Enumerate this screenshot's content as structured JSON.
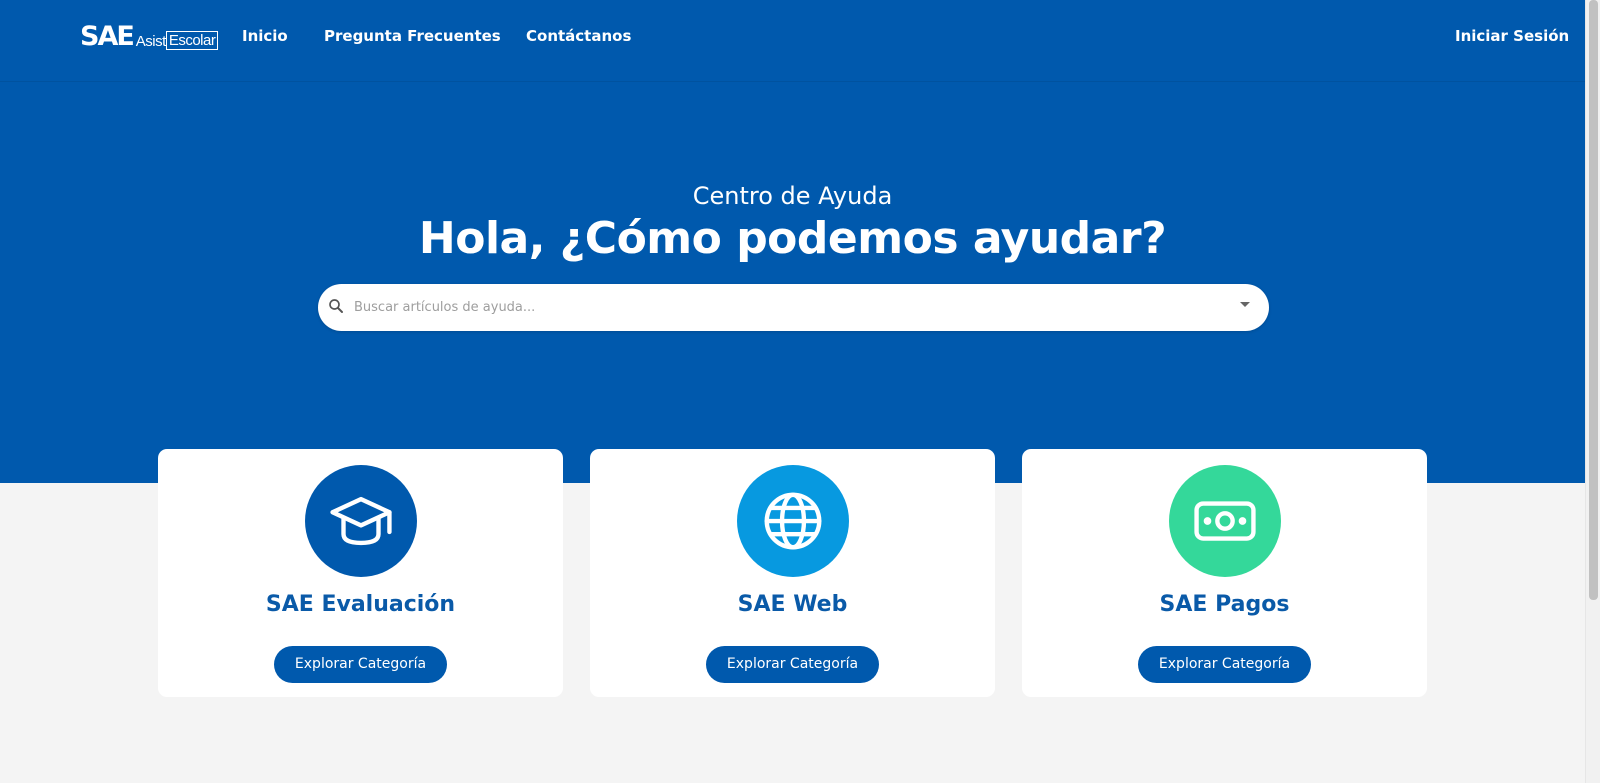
{
  "nav": {
    "logo": {
      "main": "SAE",
      "asist": "Asist",
      "escolar": "Escolar"
    },
    "links": [
      "Inicio",
      "Pregunta Frecuentes",
      "Contáctanos"
    ],
    "login": "Iniciar Sesión"
  },
  "hero": {
    "subtitle": "Centro de Ayuda",
    "title": "Hola, ¿Cómo podemos ayudar?"
  },
  "search": {
    "placeholder": "Buscar artículos de ayuda...",
    "icon": "search-icon",
    "dropdown_icon": "caret-down-icon"
  },
  "cards": [
    {
      "title": "SAE Evaluación",
      "icon": "graduation-cap-icon",
      "color": "#0059ad",
      "button": "Explorar Categoría"
    },
    {
      "title": "SAE Web",
      "icon": "globe-icon",
      "color": "#0799e0",
      "button": "Explorar Categoría"
    },
    {
      "title": "SAE Pagos",
      "icon": "money-icon",
      "color": "#34d89a",
      "button": "Explorar Categoría"
    }
  ],
  "colors": {
    "primary": "#0059ad",
    "heading": "#0a5aa8",
    "background": "#f4f4f4"
  }
}
